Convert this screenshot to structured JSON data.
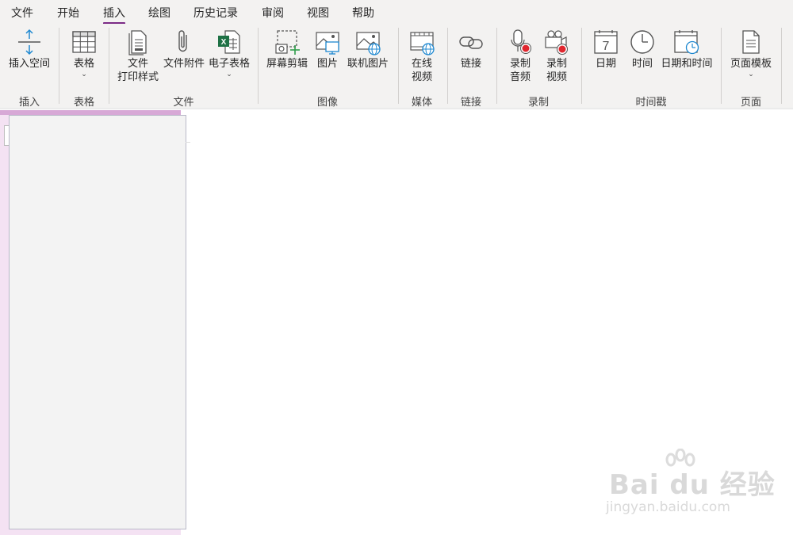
{
  "menu": {
    "tabs": [
      {
        "label": "文件"
      },
      {
        "label": "开始"
      },
      {
        "label": "插入"
      },
      {
        "label": "绘图"
      },
      {
        "label": "历史记录"
      },
      {
        "label": "审阅"
      },
      {
        "label": "视图"
      },
      {
        "label": "帮助"
      }
    ],
    "active_tab": "插入",
    "accent_color": "#7b2b86"
  },
  "ribbon": {
    "buttons": {
      "insert_space": {
        "label": "插入空间",
        "icon": "insert-space-icon"
      },
      "table": {
        "label": "表格",
        "icon": "table-icon"
      },
      "file_printout": {
        "label1": "文件",
        "label2": "打印样式",
        "icon": "file-printout-icon"
      },
      "file_attachment": {
        "label": "文件附件",
        "icon": "paperclip-icon"
      },
      "spreadsheet": {
        "label": "电子表格",
        "icon": "excel-icon"
      },
      "screen_clipping": {
        "label": "屏幕剪辑",
        "icon": "screen-clipping-icon"
      },
      "picture": {
        "label": "图片",
        "icon": "picture-icon"
      },
      "online_picture": {
        "label": "联机图片",
        "icon": "online-picture-icon"
      },
      "online_video": {
        "label1": "在线",
        "label2": "视频",
        "icon": "online-video-icon"
      },
      "link": {
        "label": "链接",
        "icon": "link-icon"
      },
      "record_audio": {
        "label1": "录制",
        "label2": "音频",
        "icon": "record-audio-icon"
      },
      "record_video": {
        "label1": "录制",
        "label2": "视频",
        "icon": "record-video-icon"
      },
      "date": {
        "label": "日期",
        "icon": "calendar-icon",
        "day": "7"
      },
      "time": {
        "label": "时间",
        "icon": "clock-icon"
      },
      "date_time": {
        "label": "日期和时间",
        "icon": "date-time-icon"
      },
      "page_templates": {
        "label": "页面模板",
        "icon": "page-template-icon"
      }
    },
    "groups": {
      "insert": "插入",
      "tables": "表格",
      "files": "文件",
      "images": "图像",
      "media": "媒体",
      "links": "链接",
      "recording": "录制",
      "timestamp": "时间戳",
      "pages": "页面"
    }
  },
  "section_color": "#f4e2f3",
  "watermark": {
    "main": "Bai du 经验",
    "sub": "jingyan.baidu.com"
  }
}
